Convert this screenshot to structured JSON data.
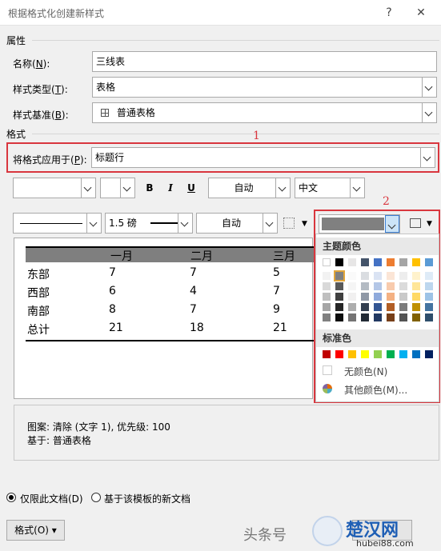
{
  "window": {
    "title": "根据格式化创建新样式",
    "help": "?",
    "close": "✕"
  },
  "properties": {
    "section_label": "属性",
    "name_label": "名称(",
    "name_key": "N",
    "name_tail": "):",
    "name_value": "三线表",
    "type_label": "样式类型(",
    "type_key": "T",
    "type_tail": "):",
    "type_value": "表格",
    "base_label": "样式基准(",
    "base_key": "B",
    "base_tail": "):",
    "base_value": "普通表格"
  },
  "format": {
    "section_label": "格式",
    "apply_label": "将格式应用于(",
    "apply_key": "P",
    "apply_tail": "):",
    "apply_value": "标题行",
    "font_color": "自动",
    "lang": "中文",
    "bold": "B",
    "italic": "I",
    "underline": "U",
    "border_weight": "1.5 磅",
    "border_color": "自动"
  },
  "annotations": {
    "one": "1",
    "two": "2"
  },
  "preview": {
    "headers": [
      "一月",
      "二月",
      "三月"
    ],
    "rows": [
      {
        "label": "东部",
        "values": [
          "7",
          "7",
          "5"
        ]
      },
      {
        "label": "西部",
        "values": [
          "6",
          "4",
          "7"
        ]
      },
      {
        "label": "南部",
        "values": [
          "8",
          "7",
          "9"
        ]
      },
      {
        "label": "总计",
        "values": [
          "21",
          "18",
          "21"
        ]
      }
    ]
  },
  "palette": {
    "theme_label": "主题颜色",
    "standard_label": "标准色",
    "no_color": "无颜色(N)",
    "more_colors": "其他颜色(M)...",
    "theme_top": [
      "#ffffff",
      "#000000",
      "#e7e6e6",
      "#44546a",
      "#4472c4",
      "#ed7d31",
      "#a5a5a5",
      "#ffc000",
      "#5b9bd5"
    ],
    "standard": [
      "#c00000",
      "#ff0000",
      "#ffc000",
      "#ffff00",
      "#92d050",
      "#00b050",
      "#00b0f0",
      "#0070c0",
      "#002060"
    ],
    "selected_color": "#808080"
  },
  "description": {
    "line1": "图案: 清除 (文字 1), 优先级: 100",
    "line2": "基于: 普通表格"
  },
  "options": {
    "only_doc": "仅限此文档(D)",
    "template_doc": "基于该模板的新文档"
  },
  "footer": {
    "format_button": "格式(O) ▾",
    "watermark": "头条号",
    "site": "楚汉网",
    "site_url": "hubei88.com"
  }
}
